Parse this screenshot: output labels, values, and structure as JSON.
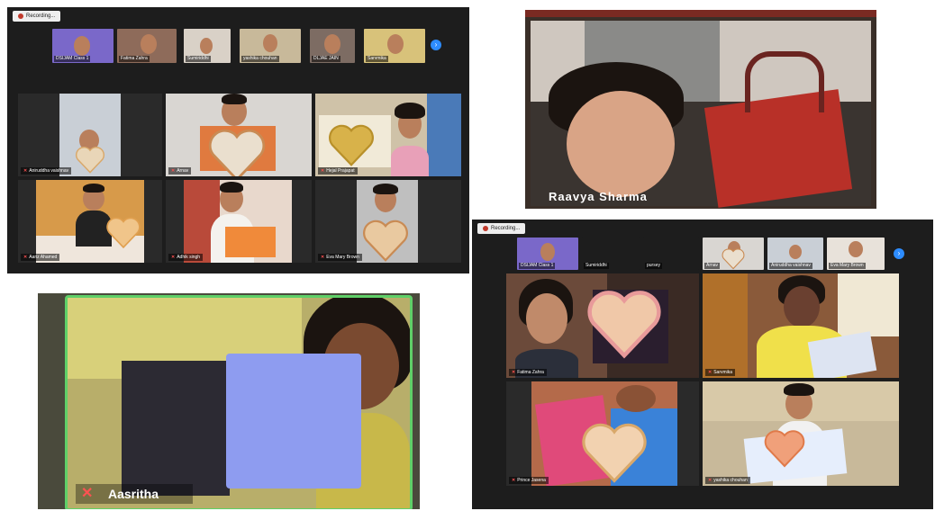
{
  "panel_a": {
    "recording_label": "Recording...",
    "thumbnails": [
      {
        "name": "DSIJAM Class 1",
        "bg": "#7a68c9"
      },
      {
        "name": "Fatima Zahra",
        "bg": "#8e6b5a"
      },
      {
        "name": "Sumiriddhi",
        "bg": "#d9d1c7"
      },
      {
        "name": "yashika chouhan",
        "bg": "#c8b99a"
      },
      {
        "name": "DLJAE JAIN",
        "bg": "#7d6c63"
      },
      {
        "name": "Sarvmika",
        "bg": "#d8c27a"
      }
    ],
    "tiles": [
      {
        "name": "Aniruddha vaishnav",
        "bg": "#c9cfd6",
        "bodyColor": "#cfc8c0"
      },
      {
        "name": "Arnav",
        "bg": "#d9d6d2",
        "bodyColor": "#e07a3f"
      },
      {
        "name": "Hejal Prajapat",
        "bg": "#cfc2a8",
        "bodyColor": "#e8a0b8"
      },
      {
        "name": "Aariz Ahamed",
        "bg": "#d79a4a",
        "bodyColor": "#222222"
      },
      {
        "name": "Adhik singh",
        "bg": "#b94a3a",
        "bodyColor": "#e8d8cc"
      },
      {
        "name": "Eva Mary Brown",
        "bg": "#bfbfbf",
        "bodyColor": "#a99f95"
      }
    ]
  },
  "panel_b": {
    "participant_name": "Raavya Sharma"
  },
  "panel_c": {
    "participant_name": "Aasritha"
  },
  "panel_d": {
    "recording_label": "Recording...",
    "thumbnails": [
      {
        "name": "DSIJAM Class 1",
        "bg": "#7a68c9"
      },
      {
        "name": "Sumiriddhi",
        "bg": "#1d1d1d"
      },
      {
        "name": "pursey",
        "bg": "#1d1d1d"
      },
      {
        "name": "Arnav",
        "bg": "#d9d6d2"
      },
      {
        "name": "Aniruddha vaishnav",
        "bg": "#c9cfd6"
      },
      {
        "name": "Eva Mary Brown",
        "bg": "#e8e2da"
      }
    ],
    "tiles": [
      {
        "name": "Fatima Zahra",
        "bg": "#6b4a3a",
        "bodyColor": "#2b2f3a"
      },
      {
        "name": "Sarvmika",
        "bg": "#8a5a3a",
        "bodyColor": "#f0e04a"
      },
      {
        "name": "Prince Jasena",
        "bg": "#4a7acc",
        "bodyColor": "#e04a7a"
      },
      {
        "name": "yashika chouhan",
        "bg": "#c8b99a",
        "bodyColor": "#f1f1f1"
      }
    ]
  },
  "colors": {
    "panel_bg": "#1d1d1d",
    "accent_blue": "#2d8cff",
    "active_speaker_border": "#5fd068",
    "mic_muted": "#ff5252"
  }
}
